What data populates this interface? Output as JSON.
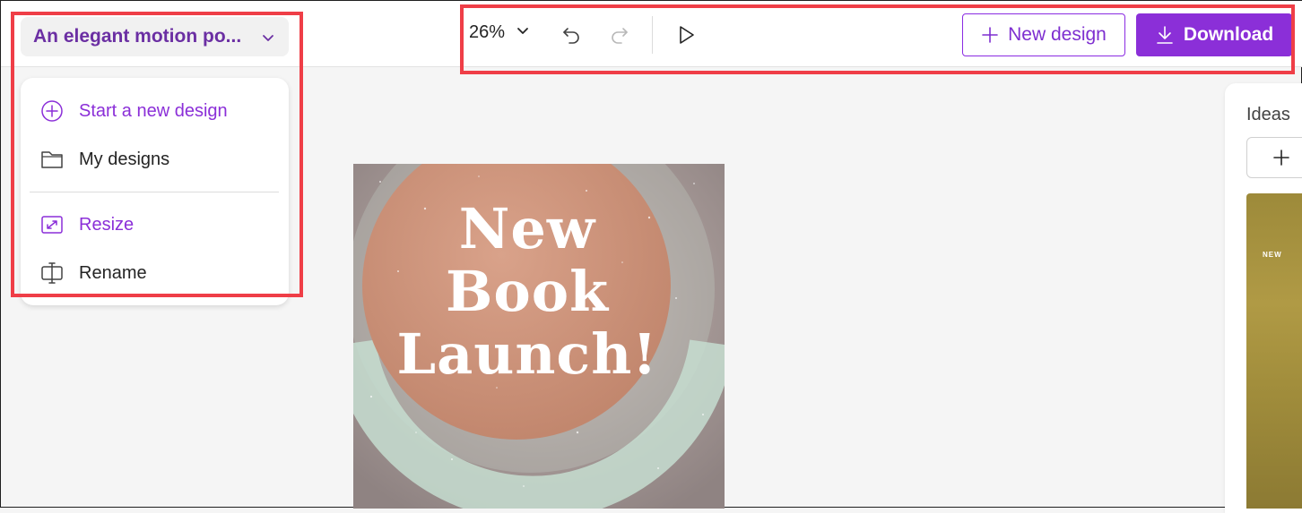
{
  "header": {
    "title": "An elegant motion po...",
    "zoom": "26%",
    "new_design_label": "New design",
    "download_label": "Download"
  },
  "menu": {
    "items": [
      {
        "label": "Start a new design",
        "icon": "plus-circle-icon",
        "color": "#8b2fd8"
      },
      {
        "label": "My designs",
        "icon": "folder-icon",
        "color": "#242424"
      },
      {
        "label": "Resize",
        "icon": "resize-icon",
        "color": "#8b2fd8"
      },
      {
        "label": "Rename",
        "icon": "rename-icon",
        "color": "#242424"
      }
    ]
  },
  "canvas": {
    "headline": [
      "New",
      "Book",
      "Launch!"
    ]
  },
  "ideas": {
    "title": "Ideas",
    "thumb_text": "NEW"
  },
  "colors": {
    "accent": "#8b2fd8",
    "title": "#6b2fa3",
    "highlight": "#ef3e47"
  }
}
